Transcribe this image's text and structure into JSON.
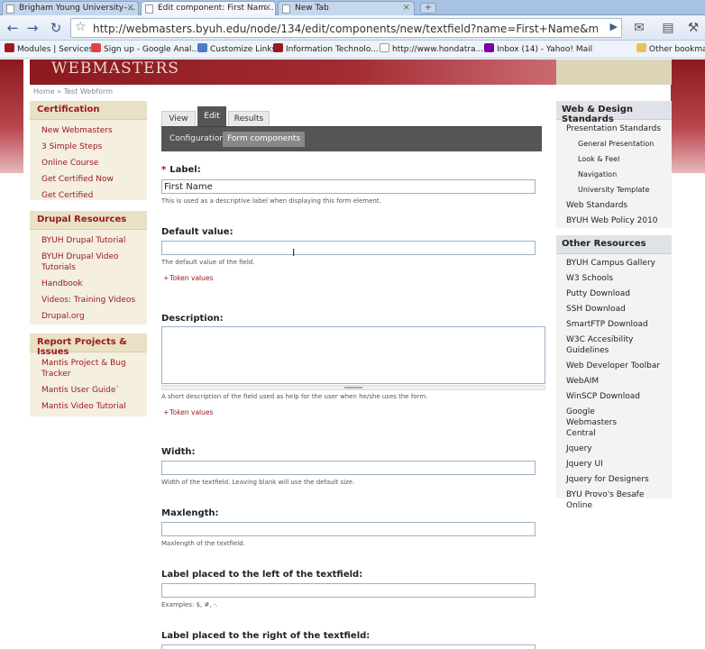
{
  "browser": {
    "tabs": [
      {
        "title": "Brigham Young University–...",
        "active": false
      },
      {
        "title": "Edit component: First Nam...",
        "active": true
      },
      {
        "title": "New Tab",
        "active": false
      }
    ],
    "url": "http://webmasters.byuh.edu/node/134/edit/components/new/textfield?name=First+Name&mandatory=0&email=1&",
    "bookmarks": [
      {
        "label": "Modules | Services",
        "icon": "byu-icon"
      },
      {
        "label": "Sign up - Google Anal...",
        "icon": "gmail-icon"
      },
      {
        "label": "Customize Links",
        "icon": "customize-icon"
      },
      {
        "label": "Information Technolo...",
        "icon": "byu-icon"
      },
      {
        "label": "http://www.hondatra...",
        "icon": "page-icon"
      },
      {
        "label": "Inbox (14) - Yahoo! Mail",
        "icon": "yahoo-icon"
      },
      {
        "label": "Other bookmarks",
        "icon": "folder-icon"
      }
    ]
  },
  "site": {
    "logo": "WEBMASTERS",
    "breadcrumb": [
      "Home",
      "Test Webform"
    ]
  },
  "left_sidebar": [
    {
      "title": "Certification",
      "items": [
        "New Webmasters",
        "3 Simple Steps",
        "Online Course",
        "Get Certified Now",
        "Get Certified"
      ]
    },
    {
      "title": "Drupal Resources",
      "items": [
        "BYUH Drupal Tutorial",
        "BYUH Drupal Video Tutorials",
        "Handbook",
        "Videos: Training Videos",
        "Drupal.org"
      ]
    },
    {
      "title": "Report Projects & Issues",
      "items": [
        "Mantis Project & Bug Tracker",
        "Mantis User Guide`",
        "Mantis Video Tutorial"
      ]
    }
  ],
  "right_sidebar": [
    {
      "title": "Web & Design Standards",
      "items": [
        {
          "label": "Presentation Standards",
          "sub": false
        },
        {
          "label": "General Presentation",
          "sub": true
        },
        {
          "label": "Look & Feel",
          "sub": true
        },
        {
          "label": "Navigation",
          "sub": true
        },
        {
          "label": "University Template",
          "sub": true
        },
        {
          "label": "Web Standards",
          "sub": false
        },
        {
          "label": "BYUH Web Policy 2010",
          "sub": false
        }
      ]
    },
    {
      "title": "Other Resources",
      "items": [
        {
          "label": "BYUH Campus Gallery",
          "sub": false
        },
        {
          "label": "W3 Schools",
          "sub": false
        },
        {
          "label": "Putty Download",
          "sub": false
        },
        {
          "label": "SSH Download",
          "sub": false
        },
        {
          "label": "SmartFTP Download",
          "sub": false
        },
        {
          "label": "W3C Accesibility Guidelines",
          "sub": false
        },
        {
          "label": "Web Developer Toolbar",
          "sub": false
        },
        {
          "label": "WebAIM",
          "sub": false
        },
        {
          "label": "WinSCP Download",
          "sub": false
        },
        {
          "label": "Google Webmasters Central",
          "sub": false
        },
        {
          "label": "Jquery",
          "sub": false
        },
        {
          "label": "Jquery UI",
          "sub": false
        },
        {
          "label": "Jquery for Designers",
          "sub": false
        },
        {
          "label": "BYU Provo's Besafe Online",
          "sub": false
        }
      ]
    }
  ],
  "tabs": {
    "view": "View",
    "edit": "Edit",
    "results": "Results"
  },
  "subtabs": {
    "configuration": "Configuration",
    "form_components": "Form components"
  },
  "form": {
    "label": {
      "title": "Label:",
      "required": "*",
      "value": "First Name",
      "help": "This is used as a descriptive label when displaying this form element."
    },
    "default_value": {
      "title": "Default value:",
      "value": "",
      "help": "The default value of the field.",
      "token": "Token values"
    },
    "description": {
      "title": "Description:",
      "value": "",
      "help": "A short description of the field used as help for the user when he/she uses the form.",
      "token": "Token values"
    },
    "width": {
      "title": "Width:",
      "value": "",
      "help": "Width of the textfield. Leaving blank will use the default size."
    },
    "maxlength": {
      "title": "Maxlength:",
      "value": "",
      "help": "Maxlength of the textfield."
    },
    "label_left": {
      "title": "Label placed to the left of the textfield:",
      "value": "",
      "help": "Examples: $, #, -."
    },
    "label_right": {
      "title": "Label placed to the right of the textfield:"
    }
  },
  "colors": {
    "brand": "#9b1a21",
    "header": "#8b1a1f",
    "subbar": "#555555"
  }
}
